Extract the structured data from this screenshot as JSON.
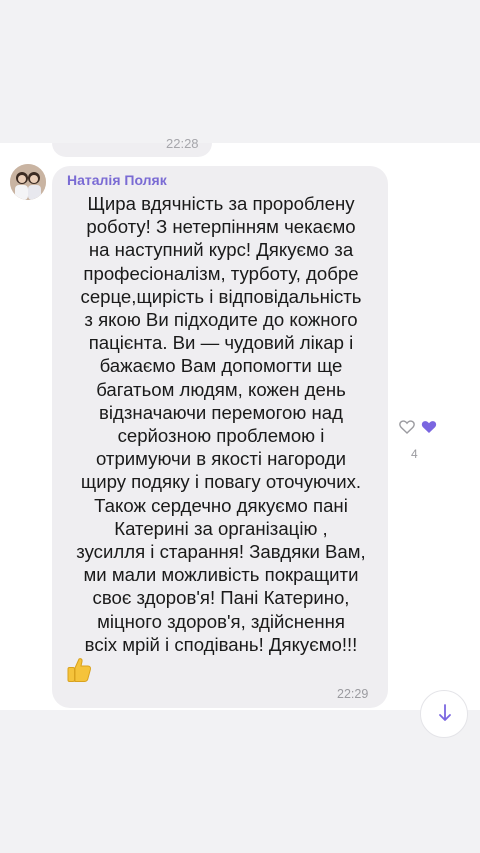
{
  "previous_message": {
    "time": "22:28"
  },
  "message": {
    "sender": "Наталія Поляк",
    "text": "Щира вдячність за пророблену\nроботу! З нетерпінням чекаємо\nна наступний курс! Дякуємо за\nпрофесіоналізм, турботу, добре\nсерце,щирість і відповідальність\nз якою Ви підходите до кожного\nпацієнта. Ви — чудовий лікар і\nбажаємо Вам допомогти ще\nбагатьом людям, кожен день\nвідзначаючи перемогою над\nсерйозною проблемою і\nотримуючи в якості нагороди\nщиру подяку і повагу оточуючих.\nТакож сердечно дякуємо пані\nКатерині за організацію ,\nзусилля і старання! Завдяки Вам,\nми мали можливість покращити\nсвоє здоров'я! Пані Катерино,\nміцного здоров'я, здійснення\nвсіх мрій і сподівань! Дякуємо!!!",
    "emoji": "thumbs-up-icon",
    "time": "22:29"
  },
  "reactions": {
    "count": "4",
    "icons": [
      "heart-outline-icon",
      "heart-filled-icon"
    ],
    "accent_color": "#7a66e0"
  },
  "colors": {
    "sender_name": "#7a6bd4",
    "bubble": "#efeef1",
    "background": "#ffffff"
  }
}
